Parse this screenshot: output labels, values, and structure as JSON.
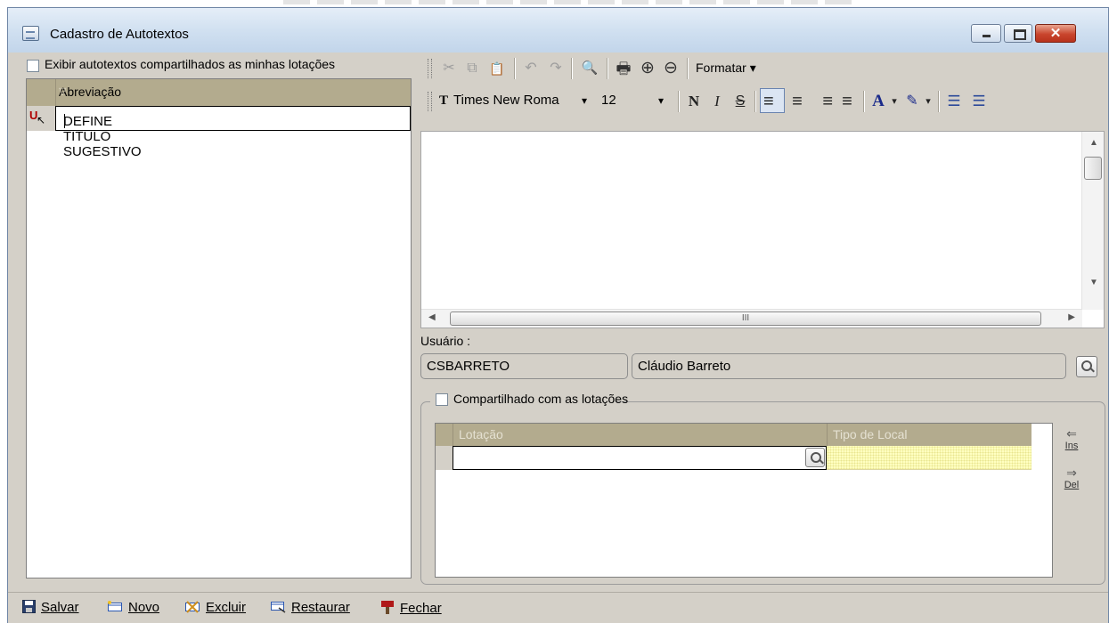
{
  "window": {
    "title": "Cadastro de Autotextos",
    "close_glyph": "✕",
    "icon": "form-icon"
  },
  "left": {
    "show_shared_label": "Exibir autotextos compartilhados as minhas lotações",
    "show_shared_checked": false,
    "grid": {
      "column": "Abreviação",
      "sort_glyph": "▽",
      "row_indicator": "U",
      "row_cursor": "↖",
      "rows": [
        "DEFINE TITULO SUGESTIVO"
      ]
    }
  },
  "toolbar": {
    "row1": {
      "cut": "✂",
      "copy": "⧉",
      "paste": "📋",
      "undo": "↶",
      "redo": "↷",
      "find": "🔍",
      "print": "🖶",
      "zoom_in": "⊕",
      "zoom_out": "⊖",
      "format_menu": "Formatar",
      "menu_arrow": "▾"
    },
    "row2": {
      "font_glyph": "T",
      "font_name": "Times New Roma",
      "font_size": "12",
      "dropdown": "▾",
      "bold": "N",
      "italic": "I",
      "strike": "S",
      "align_left": "≡",
      "align_center": "≡",
      "align_right": "≡",
      "justify": "≡",
      "font_color": "A",
      "highlight": "✎",
      "bullets": "☰",
      "numbering": "☰"
    }
  },
  "editor": {
    "scroll_up": "▲",
    "scroll_down": "▼",
    "scroll_left": "◀",
    "scroll_right": "▶",
    "hthumb_grip": "III"
  },
  "user": {
    "label": "Usuário :",
    "login": "CSBARRETO",
    "name": "Cláudio Barreto"
  },
  "sharing": {
    "legend": "Compartilhado com as lotações",
    "checked": false,
    "columns": [
      "Lotação",
      "Tipo de Local"
    ],
    "ins_label": "Ins",
    "del_label": "Del",
    "ins_glyph": "⇐",
    "del_glyph": "⇒"
  },
  "bottombar": {
    "save": "Salvar",
    "new": "Novo",
    "delete": "Excluir",
    "restore": "Restaurar",
    "close": "Fechar"
  },
  "colors": {
    "grid_header": "#b3ab8e",
    "face": "#d4d0c8",
    "highlight_cell": "#ffffc0"
  }
}
